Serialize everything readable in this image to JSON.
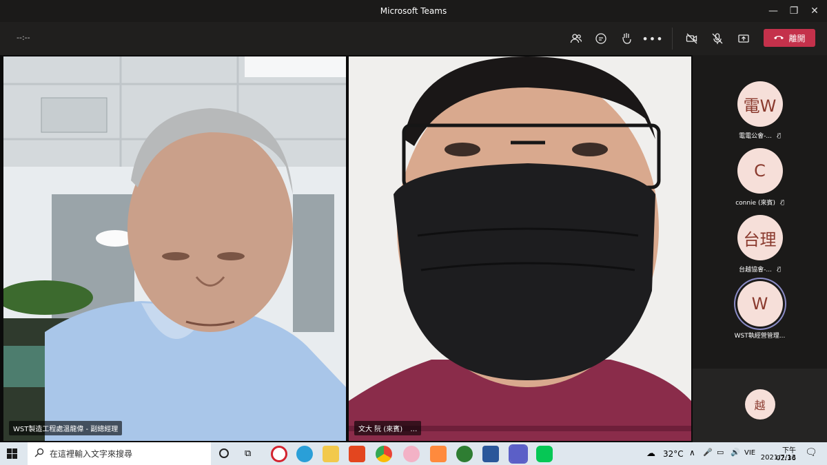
{
  "window": {
    "title": "Microsoft Teams"
  },
  "toolbar": {
    "timer": "--:--",
    "leave_label": "離開"
  },
  "videos": [
    {
      "name": "WST製造工程處溫龍偉 - 副總經理"
    },
    {
      "name": "文大 阮 (來賓)",
      "more": "…"
    }
  ],
  "participants": [
    {
      "initials": "電W",
      "name": "電電公會-..."
    },
    {
      "initials": "C",
      "name": "connie (來賓)"
    },
    {
      "initials": "台理",
      "name": "台越協會-..."
    },
    {
      "initials": "W",
      "name": "WST執經營管理..."
    },
    {
      "initials": "越",
      "name": ""
    }
  ],
  "taskbar": {
    "search_placeholder": "在這裡輸入文字來搜尋",
    "weather": "32°C",
    "lang": "VIE",
    "time": "下午 02:36",
    "date": "2021/7/13"
  },
  "colors": {
    "leave": "#c4314b",
    "avatar_bg": "#f6dfd9",
    "avatar_fg": "#8a3a2e",
    "speaking_ring": "#8b8cc7"
  }
}
